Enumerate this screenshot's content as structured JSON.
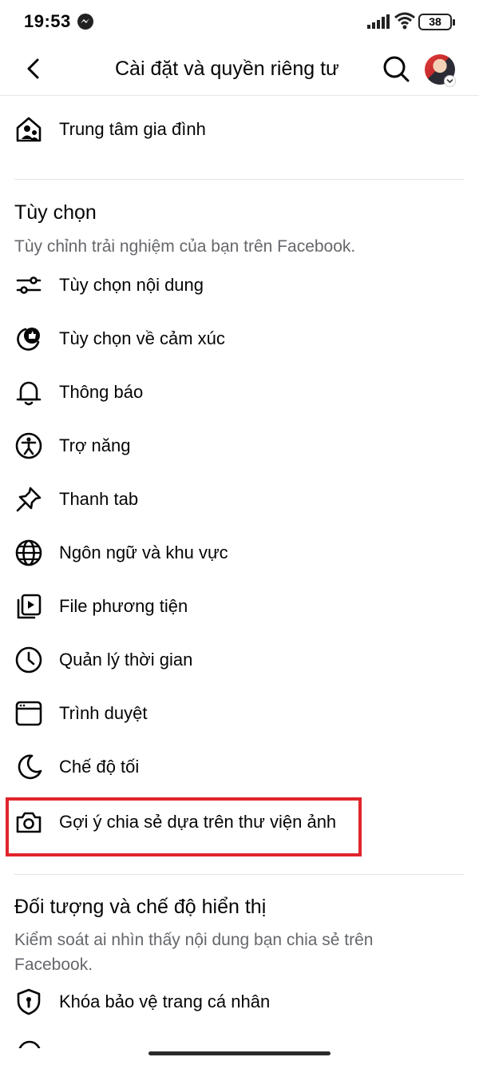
{
  "status_bar": {
    "time": "19:53",
    "battery": "38"
  },
  "header": {
    "title": "Cài đặt và quyền riêng tư"
  },
  "top_item": {
    "label": "Trung tâm gia đình",
    "icon": "family-center-icon"
  },
  "preferences": {
    "title": "Tùy chọn",
    "description": "Tùy chỉnh trải nghiệm của bạn trên Facebook.",
    "items": [
      {
        "label": "Tùy chọn nội dung",
        "icon": "sliders-icon"
      },
      {
        "label": "Tùy chọn về cảm xúc",
        "icon": "reactions-icon"
      },
      {
        "label": "Thông báo",
        "icon": "bell-icon"
      },
      {
        "label": "Trợ năng",
        "icon": "accessibility-icon"
      },
      {
        "label": "Thanh tab",
        "icon": "pin-icon"
      },
      {
        "label": "Ngôn ngữ và khu vực",
        "icon": "globe-icon"
      },
      {
        "label": "File phương tiện",
        "icon": "media-files-icon"
      },
      {
        "label": "Quản lý thời gian",
        "icon": "clock-icon"
      },
      {
        "label": "Trình duyệt",
        "icon": "browser-icon"
      },
      {
        "label": "Chế độ tối",
        "icon": "moon-icon"
      },
      {
        "label": "Gợi ý chia sẻ dựa trên thư viện ảnh",
        "icon": "camera-icon"
      }
    ]
  },
  "audience": {
    "title": "Đối tượng và chế độ hiển thị",
    "description": "Kiểm soát ai nhìn thấy nội dung bạn chia sẻ trên Facebook.",
    "items": [
      {
        "label": "Khóa bảo vệ trang cá nhân",
        "icon": "shield-lock-icon"
      }
    ]
  },
  "colors": {
    "highlight": "#e0252b",
    "secondary_text": "#65676b"
  }
}
